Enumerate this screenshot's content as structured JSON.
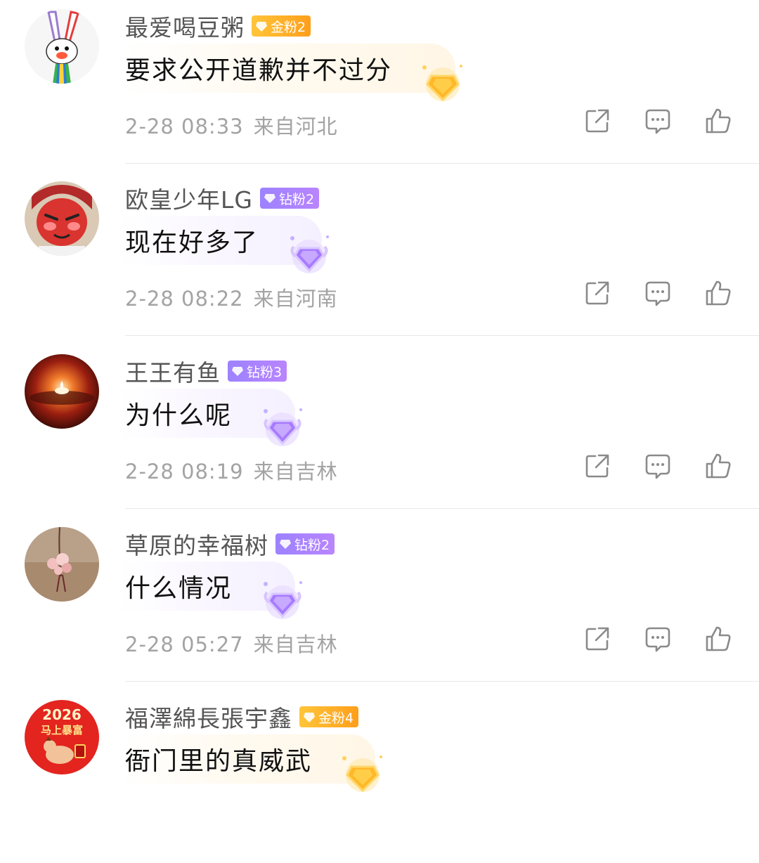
{
  "colors": {
    "username": "#555555",
    "comment_text": "#111111",
    "meta_text": "#a3a3a3",
    "gold_badge": "#ffb02e",
    "diamond_badge": "#a685ff",
    "icon_stroke": "#8a8a8a"
  },
  "comments": [
    {
      "username": "最爱喝豆粥",
      "badge": {
        "type": "gold",
        "label": "金粉2"
      },
      "text": "要求公开道歉并不过分",
      "time": "2-28 08:33",
      "location": "来自河北",
      "avatar_icon": "rabbit-avatar-icon"
    },
    {
      "username": "欧皇少年LG",
      "badge": {
        "type": "diamond",
        "label": "钻粉2"
      },
      "text": "现在好多了",
      "time": "2-28 08:22",
      "location": "来自河南",
      "avatar_icon": "cartoon-face-avatar-icon"
    },
    {
      "username": "王王有鱼",
      "badge": {
        "type": "diamond",
        "label": "钻粉3"
      },
      "text": "为什么呢",
      "time": "2-28 08:19",
      "location": "来自吉林",
      "avatar_icon": "candle-avatar-icon"
    },
    {
      "username": "草原的幸福树",
      "badge": {
        "type": "diamond",
        "label": "钻粉2"
      },
      "text": "什么情况",
      "time": "2-28 05:27",
      "location": "来自吉林",
      "avatar_icon": "flower-avatar-icon"
    },
    {
      "username": "福澤綿長張宇鑫",
      "badge": {
        "type": "gold",
        "label": "金粉4"
      },
      "text": "衙门里的真威武",
      "time": "",
      "location": "",
      "avatar_icon": "new-year-horse-avatar-icon",
      "avatar_text": {
        "year": "2026",
        "slogan": "马上暴富"
      }
    }
  ]
}
